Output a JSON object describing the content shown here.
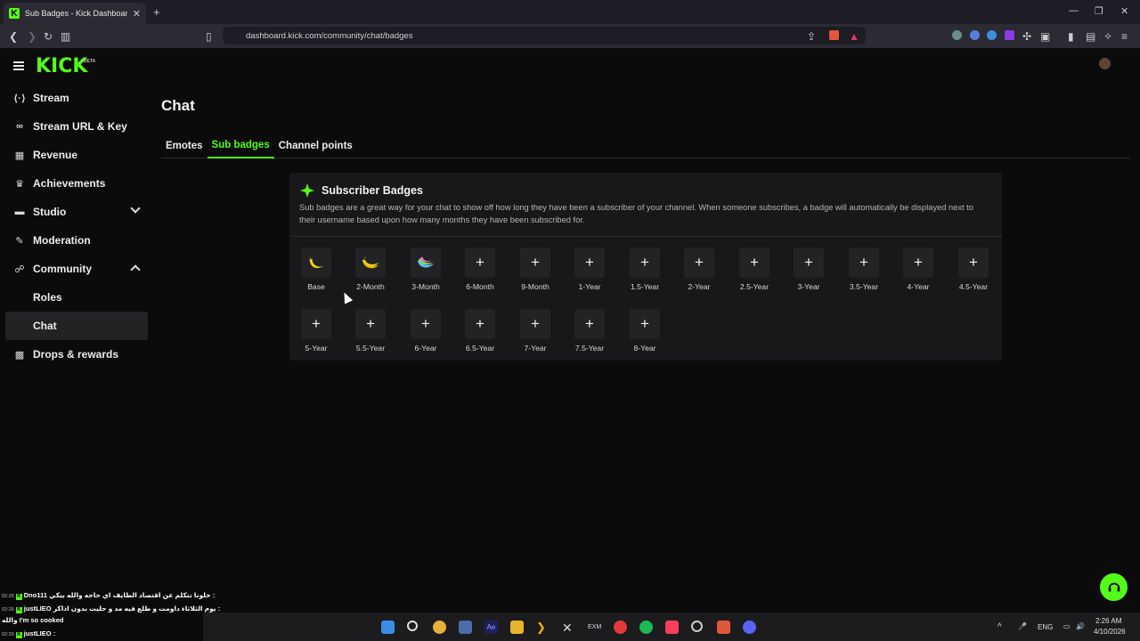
{
  "browser": {
    "tab_title": "Sub Badges - Kick Dashboard",
    "url": "dashboard.kick.com/community/chat/badges"
  },
  "brand": {
    "logo_text": "KICK",
    "logo_badge": "BETA",
    "accent_color": "#53fc18"
  },
  "sidebar": {
    "items": [
      {
        "label": "Stream",
        "icon": "broadcast-icon"
      },
      {
        "label": "Stream URL & Key",
        "icon": "link-icon"
      },
      {
        "label": "Revenue",
        "icon": "chart-icon"
      },
      {
        "label": "Achievements",
        "icon": "trophy-icon"
      },
      {
        "label": "Studio",
        "icon": "layout-icon"
      },
      {
        "label": "Moderation",
        "icon": "wrench-icon"
      },
      {
        "label": "Community",
        "icon": "people-icon"
      },
      {
        "label": "Roles"
      },
      {
        "label": "Chat"
      },
      {
        "label": "Drops & rewards",
        "icon": "gift-icon"
      }
    ]
  },
  "main": {
    "title": "Chat",
    "tabs": [
      {
        "label": "Emotes"
      },
      {
        "label": "Sub badges"
      },
      {
        "label": "Channel points"
      }
    ]
  },
  "card": {
    "title": "Subscriber Badges",
    "description": "Sub badges are a great way for your chat to show off how long they have been a subscriber of your channel. When someone subscribes, a badge will automatically be displayed next to their username based upon how many months they have been subscribed for.",
    "badges": [
      {
        "label": "Base",
        "icon": "banana-single-icon"
      },
      {
        "label": "2-Month",
        "icon": "banana-bunch-icon"
      },
      {
        "label": "3-Month",
        "icon": "banana-rainbow-icon"
      },
      {
        "label": "6-Month",
        "icon": "plus-icon"
      },
      {
        "label": "9-Month",
        "icon": "plus-icon"
      },
      {
        "label": "1-Year",
        "icon": "plus-icon"
      },
      {
        "label": "1.5-Year",
        "icon": "plus-icon"
      },
      {
        "label": "2-Year",
        "icon": "plus-icon"
      },
      {
        "label": "2.5-Year",
        "icon": "plus-icon"
      },
      {
        "label": "3-Year",
        "icon": "plus-icon"
      },
      {
        "label": "3.5-Year",
        "icon": "plus-icon"
      },
      {
        "label": "4-Year",
        "icon": "plus-icon"
      },
      {
        "label": "4.5-Year",
        "icon": "plus-icon"
      },
      {
        "label": "5-Year",
        "icon": "plus-icon"
      },
      {
        "label": "5.5-Year",
        "icon": "plus-icon"
      },
      {
        "label": "6-Year",
        "icon": "plus-icon"
      },
      {
        "label": "6.5-Year",
        "icon": "plus-icon"
      },
      {
        "label": "7-Year",
        "icon": "plus-icon"
      },
      {
        "label": "7.5-Year",
        "icon": "plus-icon"
      },
      {
        "label": "8-Year",
        "icon": "plus-icon"
      }
    ]
  },
  "chat_overlay": {
    "lines": [
      {
        "time": "02:26",
        "user": "Dno111",
        "text": "خلونا نتكلم عن اقتصاد الطايف اي حاجه والله بيكي :"
      },
      {
        "time": "02:26",
        "user": "justLIEO",
        "text": "يوم الثلاثاء داومت و طلع فيه مد و حليت بدون اذاكر :"
      },
      {
        "time": "",
        "user": "",
        "text": "والله I'm so cooked"
      },
      {
        "time": "02:26",
        "user": "justLIEO",
        "text": ":"
      }
    ]
  },
  "taskbar": {
    "language": "ENG",
    "time": "2:26 AM",
    "date": "4/10/2026"
  }
}
